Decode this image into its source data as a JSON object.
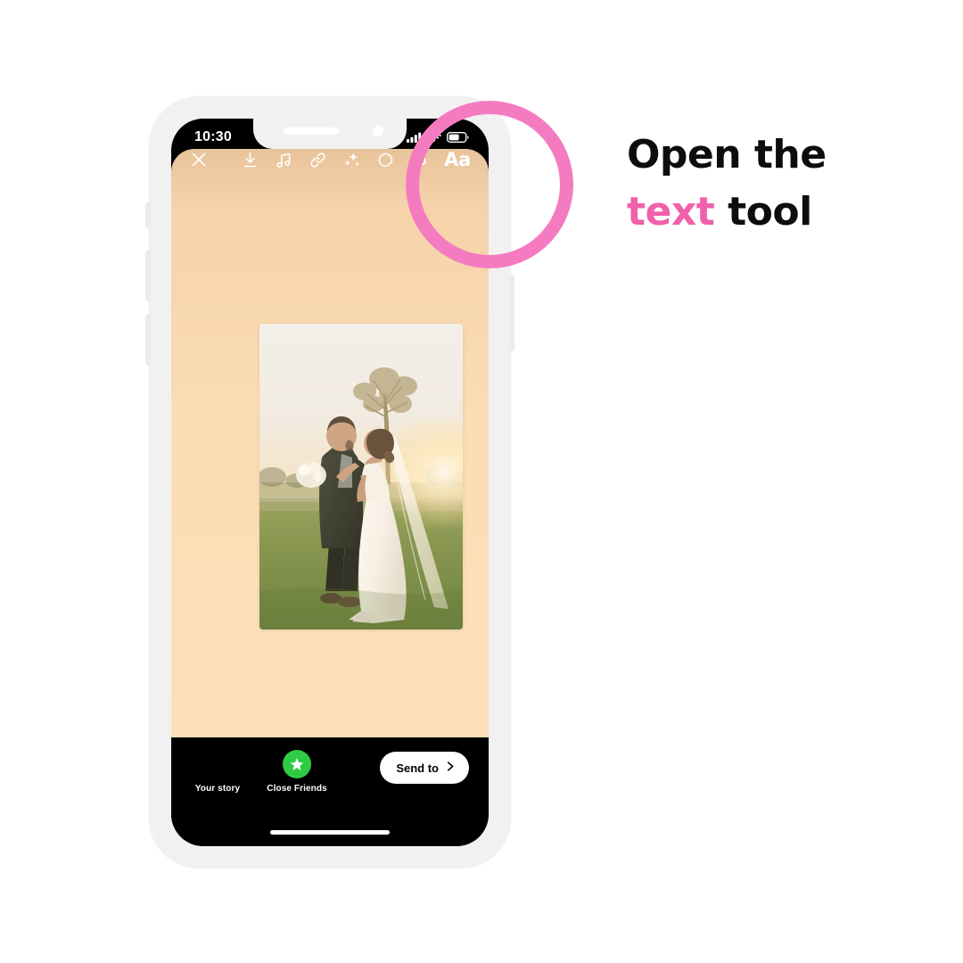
{
  "instruction": {
    "line1": "Open the",
    "line2_accent": "text",
    "line2_rest": " tool",
    "accent_color": "#f060ab"
  },
  "highlight": {
    "name": "text-tool-highlight-circle",
    "color": "#f57bc0",
    "targets": "text-tool"
  },
  "phone": {
    "status_bar": {
      "time": "10:30",
      "cellular_icon": "signal-bars-icon",
      "wifi_icon": "wifi-icon",
      "battery_icon": "battery-icon"
    },
    "story_editor": {
      "background_top_color": "#e8c39b",
      "background_bottom_color": "#fde0bb",
      "toolbar": [
        {
          "name": "close-icon",
          "label": "Close"
        },
        {
          "name": "download-icon",
          "label": "Save"
        },
        {
          "name": "music-icon",
          "label": "Music"
        },
        {
          "name": "link-icon",
          "label": "Link"
        },
        {
          "name": "sparkles-icon",
          "label": "Effects"
        },
        {
          "name": "sticker-icon",
          "label": "Stickers"
        },
        {
          "name": "draw-icon",
          "label": "Draw"
        },
        {
          "name": "text-icon",
          "label": "Aa"
        }
      ],
      "photo": {
        "name": "wedding-photo-sticker",
        "description": "Bride and groom embracing at sunset on a grass lawn"
      }
    },
    "share_bar": {
      "options": [
        {
          "name": "your-story",
          "label": "Your story"
        },
        {
          "name": "close-friends",
          "label": "Close Friends"
        }
      ],
      "send_to_label": "Send to",
      "send_to_chevron": "chevron-right-icon"
    }
  }
}
